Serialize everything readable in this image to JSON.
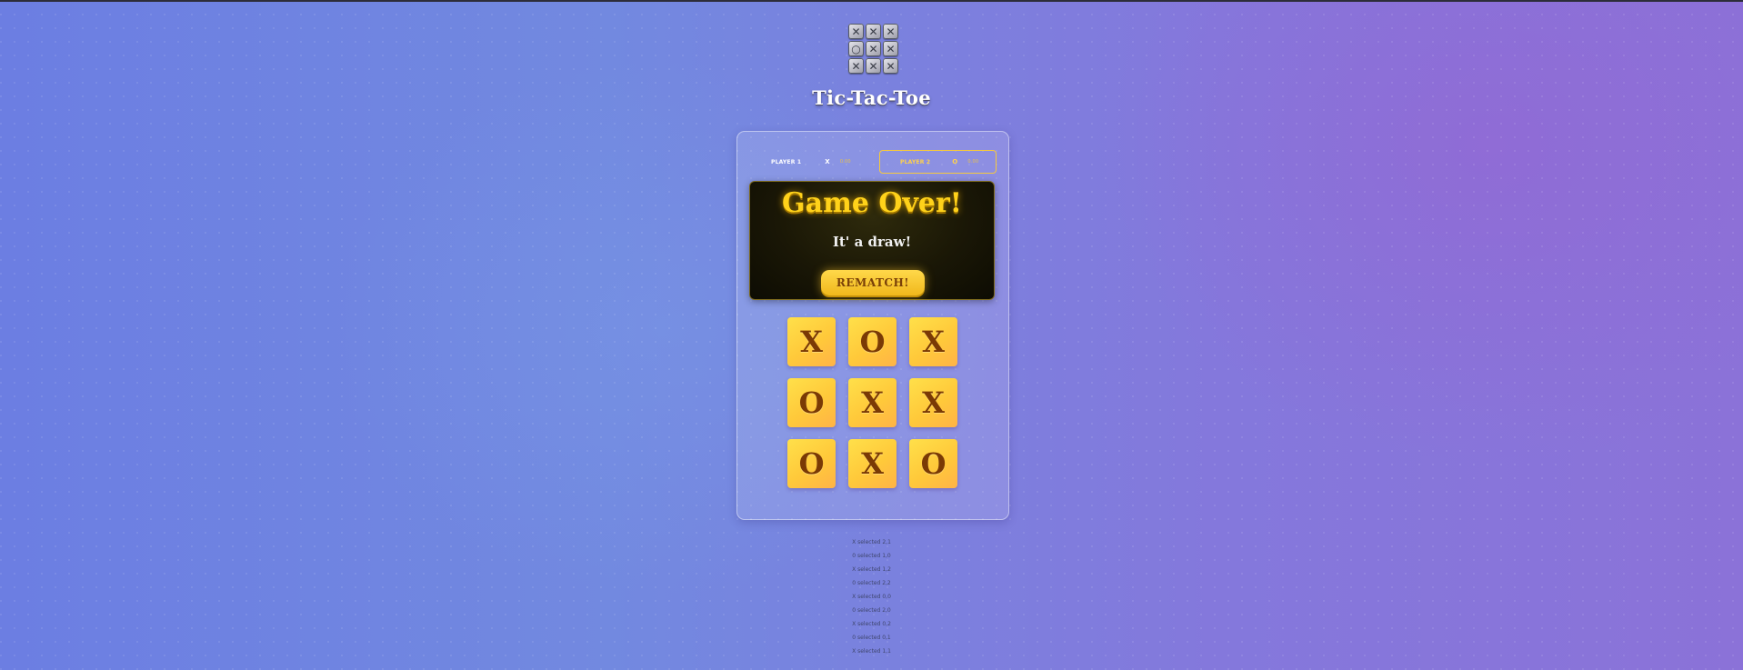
{
  "app": {
    "title": "Tic-Tac-Toe",
    "logo_tiles": [
      "✕",
      "✕",
      "✕",
      "○",
      "✕",
      "✕",
      "✕",
      "✕",
      "✕"
    ]
  },
  "players": [
    {
      "label": "PLAYER 1",
      "mark": "X",
      "score": "0.00",
      "active": false
    },
    {
      "label": "PLAYER 2",
      "mark": "O",
      "score": "0.00",
      "active": true
    }
  ],
  "game_over": {
    "title": "Game Over!",
    "message": "It' a draw!",
    "rematch_label": "REMATCH!"
  },
  "board": {
    "cells": [
      "X",
      "O",
      "X",
      "O",
      "X",
      "X",
      "O",
      "X",
      "O"
    ]
  },
  "move_log": [
    "X selected 2,1",
    "0 selected 1,0",
    "X selected 1,2",
    "0 selected 2,2",
    "X selected 0,0",
    "0 selected 2,0",
    "X selected 0,2",
    "0 selected 0,1",
    "X selected 1,1"
  ],
  "colors": {
    "accent": "#ffd21a",
    "cell_bg": "#ffc93a",
    "mark": "#7a3a05",
    "bg_left": "#6c7ee2",
    "bg_right": "#8b72d8"
  }
}
